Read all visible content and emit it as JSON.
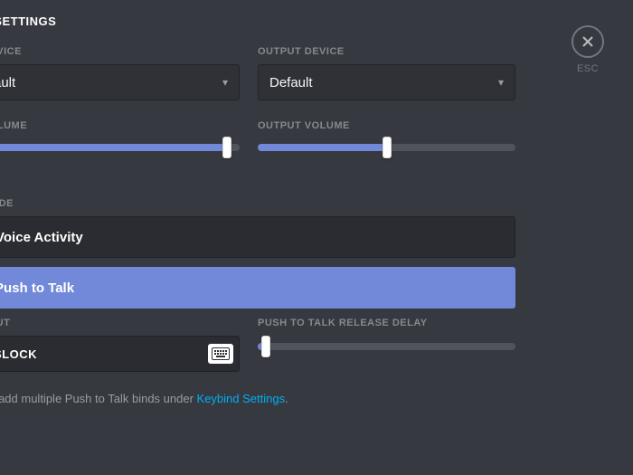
{
  "header": {
    "title": "E SETTINGS"
  },
  "close": {
    "esc_label": "ESC"
  },
  "input_device": {
    "label": "DEVICE",
    "value": "ault"
  },
  "output_device": {
    "label": "OUTPUT DEVICE",
    "value": "Default"
  },
  "input_volume": {
    "label": "VOLUME",
    "percent": 95
  },
  "output_volume": {
    "label": "OUTPUT VOLUME",
    "percent": 50
  },
  "mode": {
    "label": "MODE",
    "options": {
      "voice_activity": "Voice Activity",
      "push_to_talk": "Push to Talk"
    },
    "selected": "push_to_talk"
  },
  "shortcut": {
    "label": "TCUT",
    "value": "SLOCK"
  },
  "ptt_delay": {
    "label": "PUSH TO TALK RELEASE DELAY",
    "percent": 3
  },
  "hint": {
    "prefix": "an add multiple Push to Talk binds under ",
    "link": "Keybind Settings",
    "suffix": "."
  }
}
